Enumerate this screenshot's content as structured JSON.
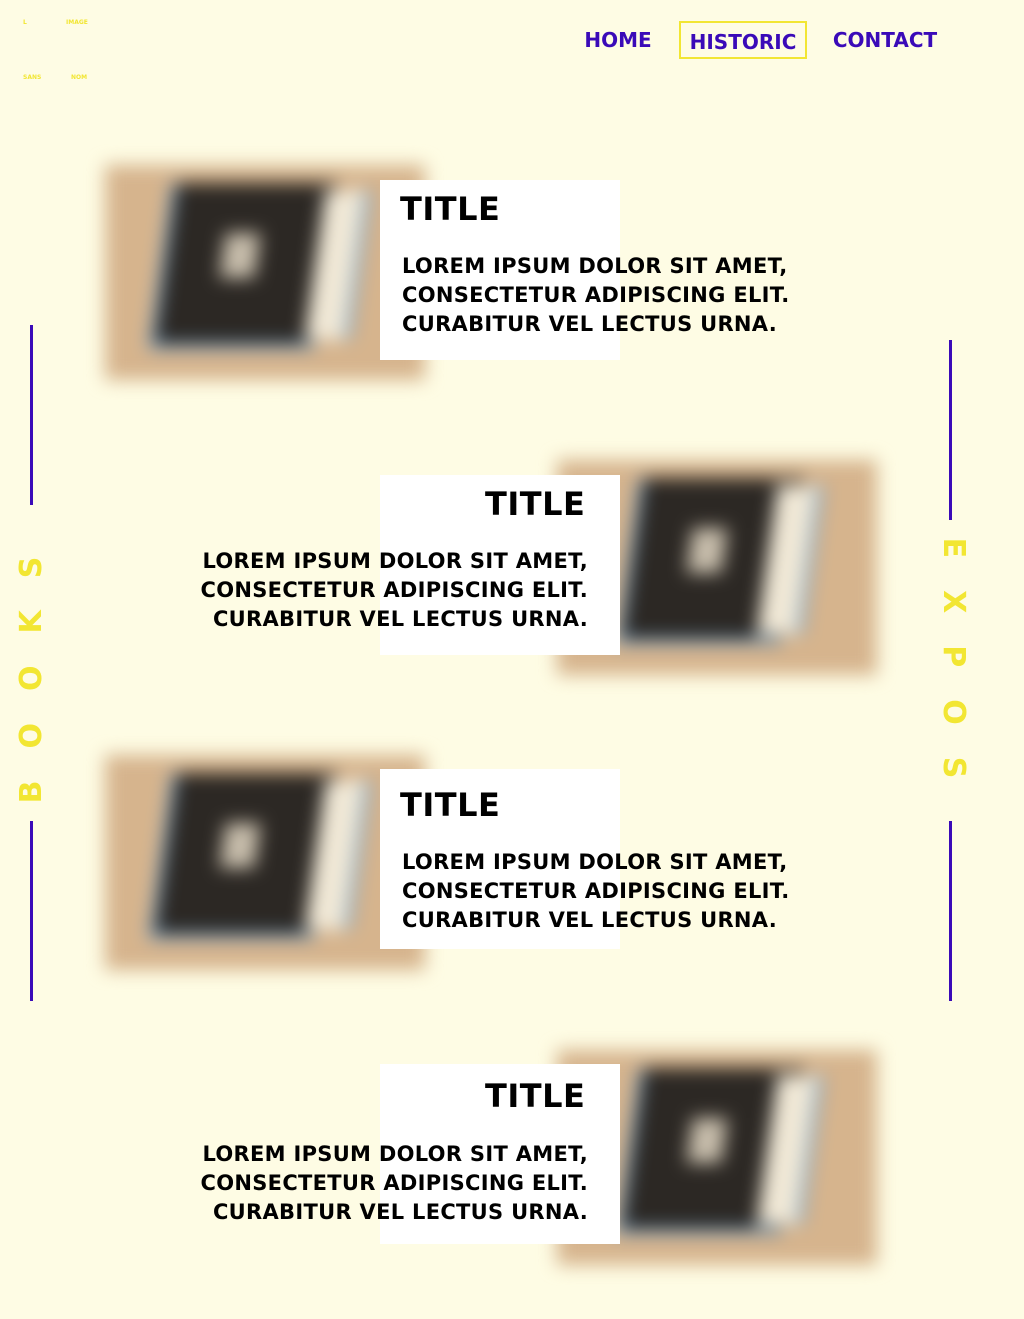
{
  "logo": {
    "labels": [
      "L",
      "IMAGE",
      "SANS",
      "NOM"
    ]
  },
  "nav": {
    "items": [
      {
        "label": "HOME",
        "active": false
      },
      {
        "label": "HISTORIC",
        "active": true
      },
      {
        "label": "CONTACT",
        "active": false
      }
    ]
  },
  "sidebar": {
    "left_word": "BOOKS",
    "right_word": "EXPOS"
  },
  "cards": [
    {
      "title": "TITLE",
      "text": "LOREM IPSUM DOLOR SIT AMET,\nCONSECTETUR ADIPISCING ELIT.\nCURABITUR VEL LECTUS URNA."
    },
    {
      "title": "TITLE",
      "text": "LOREM IPSUM DOLOR SIT AMET,\nCONSECTETUR ADIPISCING ELIT.\nCURABITUR VEL LECTUS URNA."
    },
    {
      "title": "TITLE",
      "text": "LOREM IPSUM DOLOR SIT AMET,\nCONSECTETUR ADIPISCING ELIT.\nCURABITUR VEL LECTUS URNA."
    },
    {
      "title": "TITLE",
      "text": "LOREM IPSUM DOLOR SIT AMET,\nCONSECTETUR ADIPISCING ELIT.\nCURABITUR VEL LECTUS URNA."
    }
  ],
  "colors": {
    "background": "#fefce4",
    "accent_yellow": "#f2e632",
    "accent_purple": "#3a0ab8",
    "text": "#000000",
    "card_background": "#ffffff"
  }
}
